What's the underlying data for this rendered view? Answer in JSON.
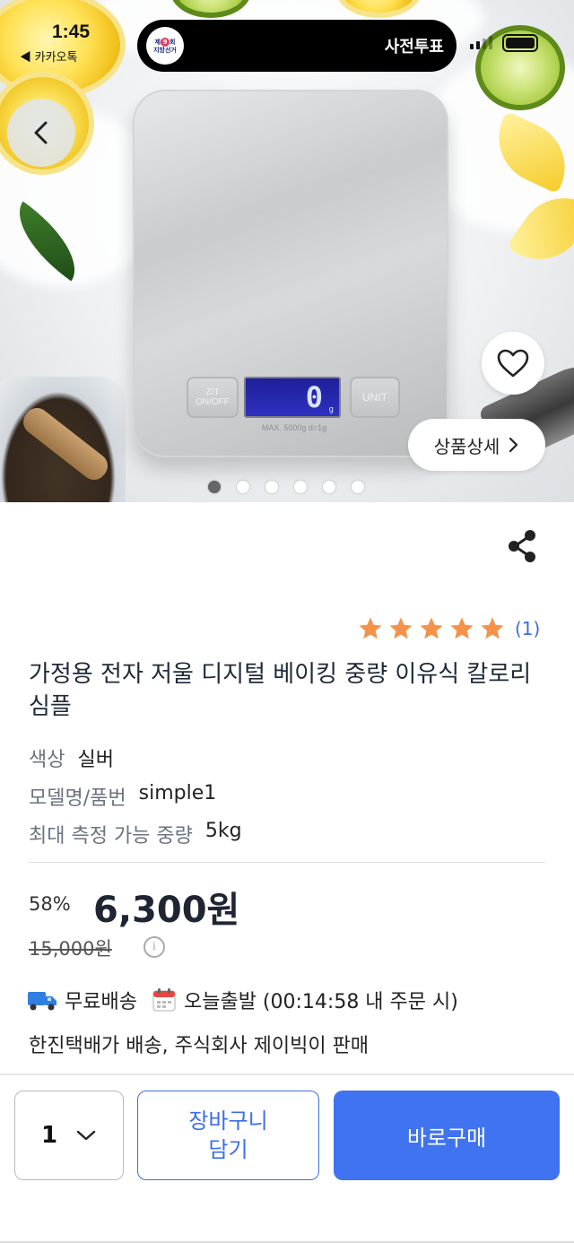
{
  "status_bar": {
    "time": "1:45",
    "back_app": "◀ 카카오톡"
  },
  "island": {
    "logo_top": "제",
    "logo_num": "9",
    "logo_mid": "회",
    "logo_bottom": "지방선거",
    "text": "사전투표"
  },
  "hero": {
    "scale": {
      "left_button": "Z/T\nON/OFF",
      "right_button": "UNIT",
      "display_value": "0",
      "display_unit": "g",
      "max_label": "MAX. 5000g d=1g"
    },
    "detail_button": "상품상세",
    "dots_count": 6,
    "active_dot": 1
  },
  "product": {
    "rating_stars": 5,
    "rating_count": "(1)",
    "title": "가정용 전자 저울 디지털 베이킹 중량 이유식 칼로리 심플",
    "specs": [
      {
        "key": "색상",
        "value": "실버"
      },
      {
        "key": "모델명/품번",
        "value": "simple1"
      },
      {
        "key": "최대 측정 가능 중량",
        "value": "5kg"
      }
    ],
    "discount": "58%",
    "price": "6,300원",
    "original_price": "15,000원",
    "info_icon": "i",
    "shipping": {
      "free": "무료배송",
      "today": "오늘출발 (00:14:58 내 주문 시)"
    },
    "seller": "한진택배가 배송, 주식회사 제이빅이 판매"
  },
  "bottom_bar": {
    "quantity": "1",
    "cart_label": "장바구니\n담기",
    "buy_label": "바로구매"
  },
  "colors": {
    "accent": "#3f73f0",
    "star": "#f5924a",
    "rating_text": "#3a6fd8"
  }
}
